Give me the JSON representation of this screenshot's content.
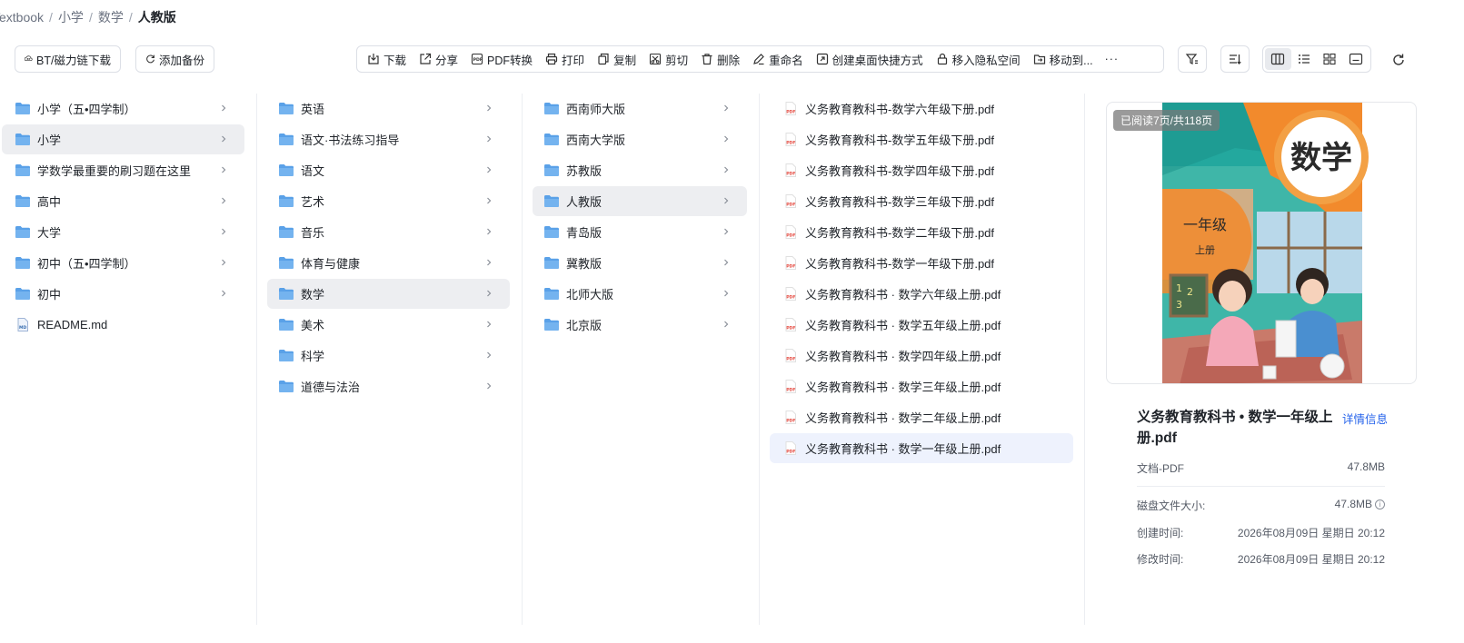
{
  "breadcrumb": [
    "Textbook",
    "小学",
    "数学",
    "人教版"
  ],
  "left_buttons": {
    "bt": "BT/磁力链下载",
    "backup": "添加备份"
  },
  "toolbar": {
    "download": "下载",
    "share": "分享",
    "pdf_convert": "PDF转换",
    "print": "打印",
    "copy": "复制",
    "cut": "剪切",
    "delete": "删除",
    "rename": "重命名",
    "shortcut": "创建桌面快捷方式",
    "private": "移入隐私空间",
    "move": "移动到...",
    "more": "···"
  },
  "column1": [
    {
      "label": "小学（五•四学制）",
      "type": "folder"
    },
    {
      "label": "小学",
      "type": "folder",
      "selected": true
    },
    {
      "label": "学数学最重要的刷习题在这里",
      "type": "folder"
    },
    {
      "label": "高中",
      "type": "folder"
    },
    {
      "label": "大学",
      "type": "folder"
    },
    {
      "label": "初中（五•四学制）",
      "type": "folder"
    },
    {
      "label": "初中",
      "type": "folder"
    },
    {
      "label": "README.md",
      "type": "md"
    }
  ],
  "column2": [
    {
      "label": "英语"
    },
    {
      "label": "语文·书法练习指导"
    },
    {
      "label": "语文"
    },
    {
      "label": "艺术"
    },
    {
      "label": "音乐"
    },
    {
      "label": "体育与健康"
    },
    {
      "label": "数学",
      "selected": true
    },
    {
      "label": "美术"
    },
    {
      "label": "科学"
    },
    {
      "label": "道德与法治"
    }
  ],
  "column3": [
    {
      "label": "西南师大版"
    },
    {
      "label": "西南大学版"
    },
    {
      "label": "苏教版"
    },
    {
      "label": "人教版",
      "selected": true
    },
    {
      "label": "青岛版"
    },
    {
      "label": "冀教版"
    },
    {
      "label": "北师大版"
    },
    {
      "label": "北京版"
    }
  ],
  "column4": [
    {
      "label": "义务教育教科书-数学六年级下册.pdf"
    },
    {
      "label": "义务教育教科书-数学五年级下册.pdf"
    },
    {
      "label": "义务教育教科书-数学四年级下册.pdf"
    },
    {
      "label": "义务教育教科书-数学三年级下册.pdf"
    },
    {
      "label": "义务教育教科书-数学二年级下册.pdf"
    },
    {
      "label": "义务教育教科书-数学一年级下册.pdf"
    },
    {
      "label": "义务教育教科书 · 数学六年级上册.pdf"
    },
    {
      "label": "义务教育教科书 · 数学五年级上册.pdf"
    },
    {
      "label": "义务教育教科书 · 数学四年级上册.pdf"
    },
    {
      "label": "义务教育教科书 · 数学三年级上册.pdf"
    },
    {
      "label": "义务教育教科书 · 数学二年级上册.pdf"
    },
    {
      "label": "义务教育教科书 · 数学一年级上册.pdf",
      "selected": true
    }
  ],
  "preview": {
    "read_badge": "已阅读7页/共118页",
    "cover_title": "数学",
    "cover_grade": "一年级",
    "cover_volume": "上册",
    "file_title": "义务教育教科书 • 数学一年级上册.pdf",
    "detail_link": "详情信息",
    "type_label": "文档-PDF",
    "type_size": "47.8MB",
    "disk_label": "磁盘文件大小:",
    "disk_value": "47.8MB",
    "created_label": "创建时间:",
    "created_value": "2026年08月09日 星期日 20:12",
    "modified_label": "修改时间:",
    "modified_value": "2026年08月09日 星期日 20:12"
  },
  "colors": {
    "folder": "#5aa1e8",
    "accent": "#2563eb",
    "pdf": "#e5483e",
    "selected": "#edeef1",
    "file_selected": "#eef2fd"
  }
}
